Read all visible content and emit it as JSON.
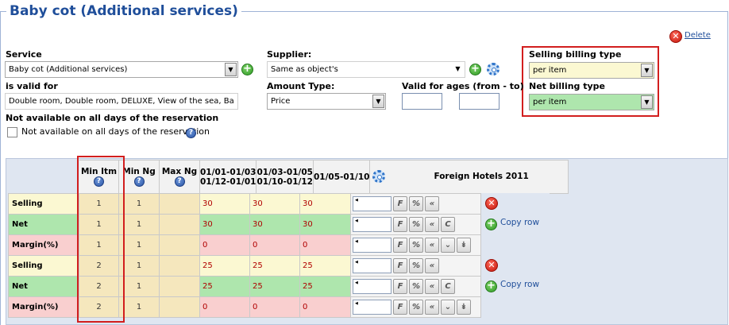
{
  "title": "Baby cot (Additional services)",
  "delete_label": "Delete",
  "form": {
    "service_label": "Service",
    "service_value": "Baby cot (Additional services)",
    "supplier_label": "Supplier:",
    "supplier_value": "Same as object's",
    "selling_billing_label": "Selling billing type",
    "selling_billing_value": "per item",
    "valid_for_label": "is valid for",
    "valid_for_value": "Double room, Double room, DELUXE, View of the sea, Ba",
    "amount_type_label": "Amount Type:",
    "amount_type_value": "Price",
    "valid_ages_label": "Valid for ages (from - to)",
    "net_billing_label": "Net billing type",
    "net_billing_value": "per item",
    "not_available_heading": "Not available on all days of the reservation",
    "not_available_checkbox_label": "Not available on all days of the reservation"
  },
  "grid": {
    "headers": {
      "min_itm": "Min Itm",
      "min_ng": "Min Ng",
      "max_ng": "Max Ng",
      "p1_line1": "01/01-01/03",
      "p1_line2": "01/12-01/01",
      "p2_line1": "01/03-01/05",
      "p2_line2": "01/10-01/12",
      "p3": "01/05-01/10",
      "hotel": "Foreign Hotels 2011"
    },
    "rows": [
      {
        "label": "Selling",
        "min_itm": "1",
        "min_ng": "1",
        "p1": "30",
        "p2": "30",
        "p3": "30"
      },
      {
        "label": "Net",
        "min_itm": "1",
        "min_ng": "1",
        "p1": "30",
        "p2": "30",
        "p3": "30"
      },
      {
        "label": "Margin(%)",
        "min_itm": "1",
        "min_ng": "1",
        "p1": "0",
        "p2": "0",
        "p3": "0"
      },
      {
        "label": "Selling",
        "min_itm": "2",
        "min_ng": "1",
        "p1": "25",
        "p2": "25",
        "p3": "25"
      },
      {
        "label": "Net",
        "min_itm": "2",
        "min_ng": "1",
        "p1": "25",
        "p2": "25",
        "p3": "25"
      },
      {
        "label": "Margin(%)",
        "min_itm": "2",
        "min_ng": "1",
        "p1": "0",
        "p2": "0",
        "p3": "0"
      }
    ],
    "copy_row_label": "Copy row",
    "btn_f": "F",
    "btn_pct": "%",
    "btn_back": "«",
    "btn_c": "C"
  },
  "colors": {
    "title": "#1f4e9a",
    "highlight_box": "#d21e1e",
    "selling_row": "#fbf8d2",
    "net_row": "#aee6ad",
    "margin_row": "#f9cfcf"
  },
  "icons": [
    "add-icon",
    "settings-gear-icon",
    "delete-icon",
    "help-icon",
    "dropdown-arrow-icon"
  ]
}
